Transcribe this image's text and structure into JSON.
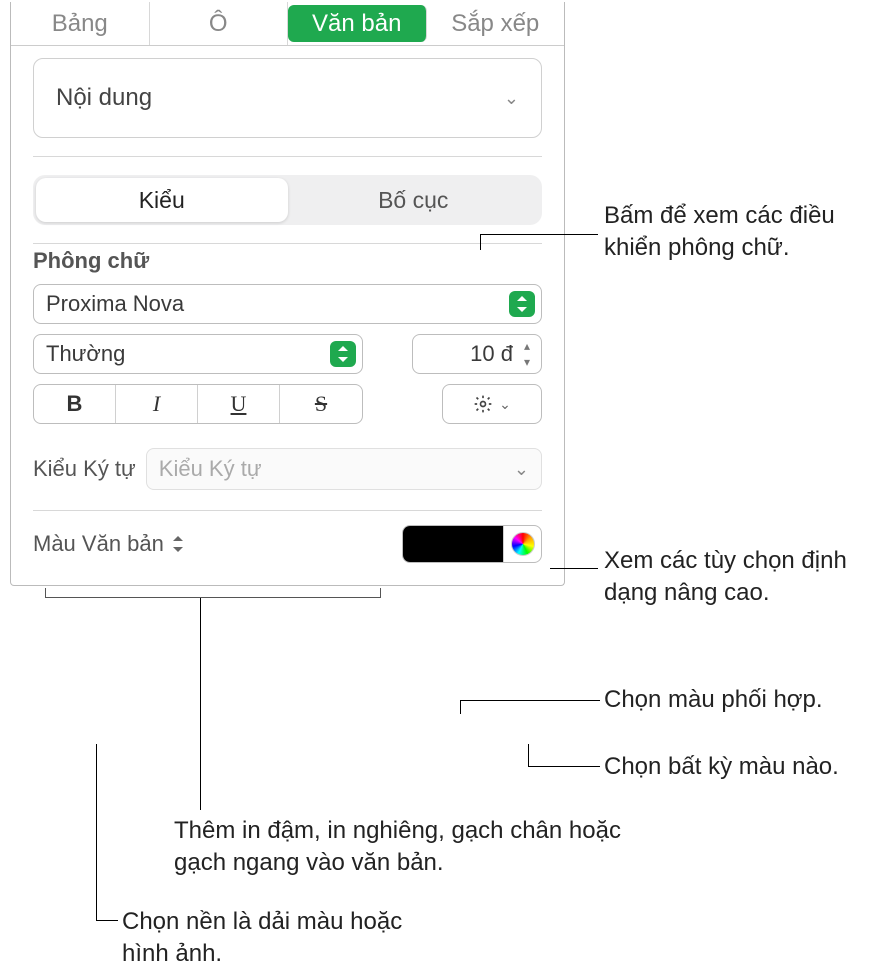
{
  "tabs": {
    "table": "Bảng",
    "cell": "Ô",
    "text": "Văn bản",
    "arrange": "Sắp xếp"
  },
  "content_select": "Nội dung",
  "subtabs": {
    "style": "Kiểu",
    "layout": "Bố cục"
  },
  "font": {
    "section_label": "Phông chữ",
    "family": "Proxima Nova",
    "weight": "Thường",
    "size": "10 đ"
  },
  "format_buttons": {
    "bold": "B",
    "italic": "I",
    "underline": "U",
    "strike": "S"
  },
  "char_style": {
    "label": "Kiểu Ký tự",
    "placeholder": "Kiểu Ký tự"
  },
  "text_color": {
    "label": "Màu Văn bản"
  },
  "callouts": {
    "font_controls": "Bấm để xem các điều khiển phông chữ.",
    "advanced": "Xem các tùy chọn định dạng nâng cao.",
    "matching_color": "Chọn màu phối hợp.",
    "any_color": "Chọn bất kỳ màu nào.",
    "bius": "Thêm in đậm, in nghiêng, gạch chân hoặc gạch ngang vào văn bản.",
    "bg": "Chọn nền là dải màu hoặc hình ảnh."
  }
}
